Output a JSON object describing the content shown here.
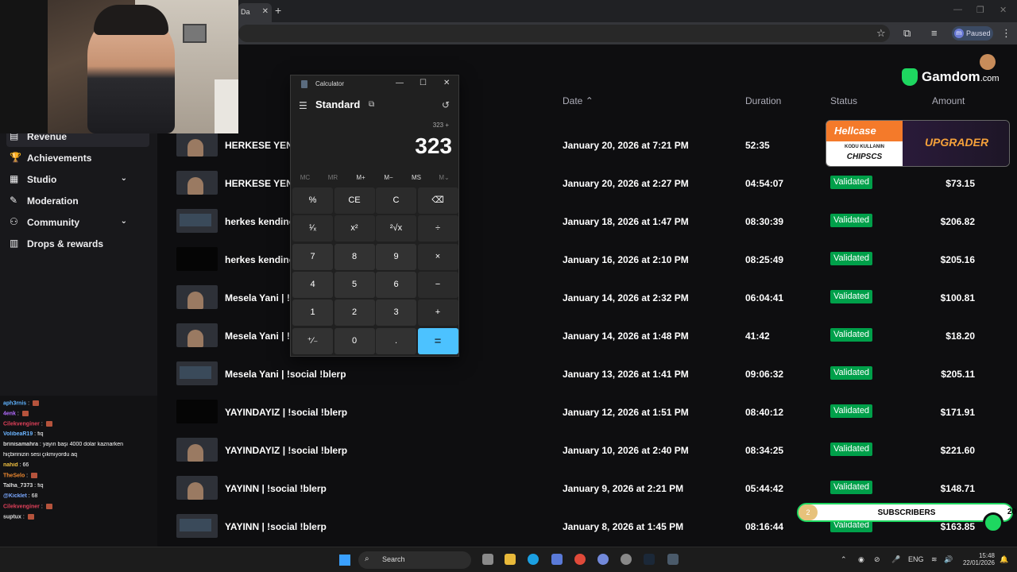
{
  "browser": {
    "tab_title": "Da",
    "paused_label": "Paused",
    "profile_letter": "m"
  },
  "sidebar": {
    "items": [
      {
        "label": "Revenue",
        "icon": "revenue-icon",
        "glyph": "▤"
      },
      {
        "label": "Achievements",
        "icon": "trophy-icon",
        "glyph": "🏆"
      },
      {
        "label": "Studio",
        "icon": "studio-icon",
        "glyph": "▦"
      },
      {
        "label": "Moderation",
        "icon": "wrench-icon",
        "glyph": "✎"
      },
      {
        "label": "Community",
        "icon": "community-icon",
        "glyph": "⚇"
      },
      {
        "label": "Drops & rewards",
        "icon": "drops-icon",
        "glyph": "▥"
      }
    ]
  },
  "table": {
    "headers": {
      "date": "Date",
      "duration": "Duration",
      "status": "Status",
      "amount": "Amount"
    },
    "rows": [
      {
        "title": "HERKESE YENİ İ",
        "date": "January 20, 2026 at 7:21 PM",
        "duration": "52:35",
        "status": "",
        "amount": ""
      },
      {
        "title": "HERKESE YENİ İ",
        "date": "January 20, 2026 at 2:27 PM",
        "duration": "04:54:07",
        "status": "Validated",
        "amount": "$73.15"
      },
      {
        "title": "herkes kendine",
        "date": "January 18, 2026 at 1:47 PM",
        "duration": "08:30:39",
        "status": "Validated",
        "amount": "$206.82"
      },
      {
        "title": "herkes kendine",
        "date": "January 16, 2026 at 2:10 PM",
        "duration": "08:25:49",
        "status": "Validated",
        "amount": "$205.16"
      },
      {
        "title": "Mesela Yani | !s",
        "date": "January 14, 2026 at 2:32 PM",
        "duration": "06:04:41",
        "status": "Validated",
        "amount": "$100.81"
      },
      {
        "title": "Mesela Yani | !s",
        "date": "January 14, 2026 at 1:48 PM",
        "duration": "41:42",
        "status": "Validated",
        "amount": "$18.20"
      },
      {
        "title": "Mesela Yani | !social !blerp",
        "date": "January 13, 2026 at 1:41 PM",
        "duration": "09:06:32",
        "status": "Validated",
        "amount": "$205.11"
      },
      {
        "title": "YAYINDAYIZ | !social !blerp",
        "date": "January 12, 2026 at 1:51 PM",
        "duration": "08:40:12",
        "status": "Validated",
        "amount": "$171.91"
      },
      {
        "title": "YAYINDAYIZ | !social !blerp",
        "date": "January 10, 2026 at 2:40 PM",
        "duration": "08:34:25",
        "status": "Validated",
        "amount": "$221.60"
      },
      {
        "title": "YAYINN | !social !blerp",
        "date": "January 9, 2026 at 2:21 PM",
        "duration": "05:44:42",
        "status": "Validated",
        "amount": "$148.71"
      },
      {
        "title": "YAYINN | !social !blerp",
        "date": "January 8, 2026 at 1:45 PM",
        "duration": "08:16:44",
        "status": "Validated",
        "amount": "$163.85"
      }
    ]
  },
  "calculator": {
    "title": "Calculator",
    "mode": "Standard",
    "expression": "323 +",
    "display": "323",
    "memory": [
      "MC",
      "MR",
      "M+",
      "M−",
      "MS",
      "M⌄"
    ],
    "keys": [
      "%",
      "CE",
      "C",
      "⌫",
      "¹⁄ₓ",
      "x²",
      "²√x",
      "÷",
      "7",
      "8",
      "9",
      "×",
      "4",
      "5",
      "6",
      "−",
      "1",
      "2",
      "3",
      "+",
      "⁺⁄₋",
      "0",
      ".",
      "="
    ]
  },
  "chat": {
    "lines": [
      {
        "user": "aph3rnis",
        "msg": "",
        "color": "#5fb3ff",
        "emote": true
      },
      {
        "user": "4enk",
        "msg": "",
        "color": "#b36bff",
        "emote": true
      },
      {
        "user": "Cilekvenginer",
        "msg": "",
        "color": "#e0405a",
        "emote": true
      },
      {
        "user": "VolibeaR19",
        "msg": "fiq",
        "color": "#6bb4ff",
        "emote": false
      },
      {
        "user": "brinisamahra",
        "msg": "yayın başı 4000 dolar kaznarken",
        "color": "#ddd",
        "emote": false
      },
      {
        "user": "",
        "msg": "hiçbirinizin sesi çıkmıyordu aq",
        "color": "#fff",
        "emote": false
      },
      {
        "user": "nahid",
        "msg": "66",
        "color": "#f0c040",
        "emote": false
      },
      {
        "user": "TheSelo",
        "msg": "",
        "color": "#f08a30",
        "emote": true
      },
      {
        "user": "Talha_7373",
        "msg": "fiq",
        "color": "#ddd",
        "emote": false
      },
      {
        "user": "@Kicklet",
        "msg": "68",
        "color": "#7aa8ff",
        "emote": false
      },
      {
        "user": "Cilekvenginer",
        "msg": "",
        "color": "#e0405a",
        "emote": true
      },
      {
        "user": "suptux",
        "msg": "",
        "color": "#ddd",
        "emote": true
      }
    ]
  },
  "overlay": {
    "gamdom_brand": "Gamdom",
    "gamdom_tld": ".com",
    "hellcase_brand": "Hellcase",
    "hellcase_sub": "KODU KULLANIN",
    "hellcase_code": "CHIPSCS",
    "hellcase_cta": "UPGRADER",
    "subs_label": "SUBSCRIBERS",
    "subs_count": "2",
    "subs_goal": "20"
  },
  "taskbar": {
    "search_placeholder": "Search",
    "lang": "ENG",
    "time": "15:48",
    "date": "22/01/2026"
  },
  "colors": {
    "validated": "#00a04a",
    "calc_equals": "#4cc2ff",
    "gamdom": "#1ed760"
  }
}
